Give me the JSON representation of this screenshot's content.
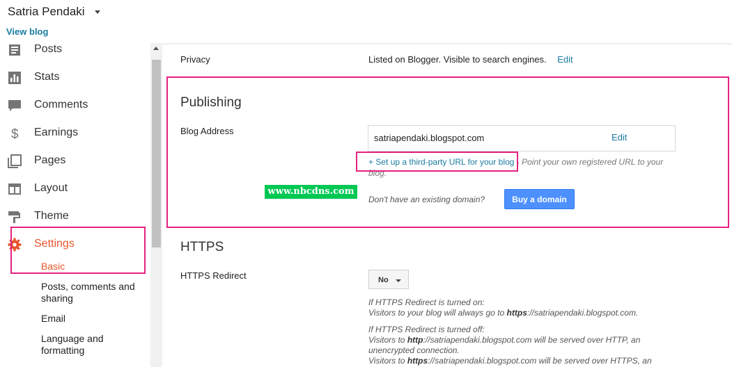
{
  "header": {
    "blog_title": "Satria Pendaki",
    "view_blog": "View blog"
  },
  "sidebar": {
    "items": [
      {
        "label": "Posts",
        "icon": "posts-icon"
      },
      {
        "label": "Stats",
        "icon": "stats-icon"
      },
      {
        "label": "Comments",
        "icon": "comments-icon"
      },
      {
        "label": "Earnings",
        "icon": "dollar-icon"
      },
      {
        "label": "Pages",
        "icon": "pages-icon"
      },
      {
        "label": "Layout",
        "icon": "layout-icon"
      },
      {
        "label": "Theme",
        "icon": "paint-roller-icon"
      },
      {
        "label": "Settings",
        "icon": "gear-icon"
      }
    ],
    "sub_items": [
      "Basic",
      "Posts, comments and sharing",
      "Email",
      "Language and formatting"
    ],
    "active_color": "#e8552d"
  },
  "main": {
    "privacy": {
      "label": "Privacy",
      "value": "Listed on Blogger. Visible to search engines.",
      "edit": "Edit"
    },
    "publishing": {
      "title": "Publishing",
      "blog_address_label": "Blog Address",
      "blog_address": "satriapendaki.blogspot.com",
      "edit": "Edit",
      "third_party_link": "+ Set up a third-party URL for your blog",
      "third_party_desc": " - Point your own registered URL to your blog.",
      "no_domain": "Don't have an existing domain?",
      "buy_domain": "Buy a domain"
    },
    "https": {
      "title": "HTTPS",
      "redirect_label": "HTTPS Redirect",
      "redirect_value": "No",
      "on_heading": "If HTTPS Redirect is turned on:",
      "on_text_prefix": "Visitors to your blog will always go to ",
      "on_text_bold": "https",
      "on_text_suffix": "://satriapendaki.blogspot.com.",
      "off_heading": "If HTTPS Redirect is turned off:",
      "off_line1_prefix": "Visitors to ",
      "off_line1_bold": "http",
      "off_line1_suffix": "://satriapendaki.blogspot.com will be served over HTTP, an unencrypted connection.",
      "off_line2_prefix": "Visitors to ",
      "off_line2_bold": "https",
      "off_line2_suffix": "://satriapendaki.blogspot.com will be served over HTTPS, an"
    }
  },
  "watermark": "www.nbcdns.com",
  "colors": {
    "link": "#1a7ba0",
    "highlight_box": "#e6217f",
    "button_blue": "#4d90fe",
    "watermark_bg": "#00c853"
  }
}
